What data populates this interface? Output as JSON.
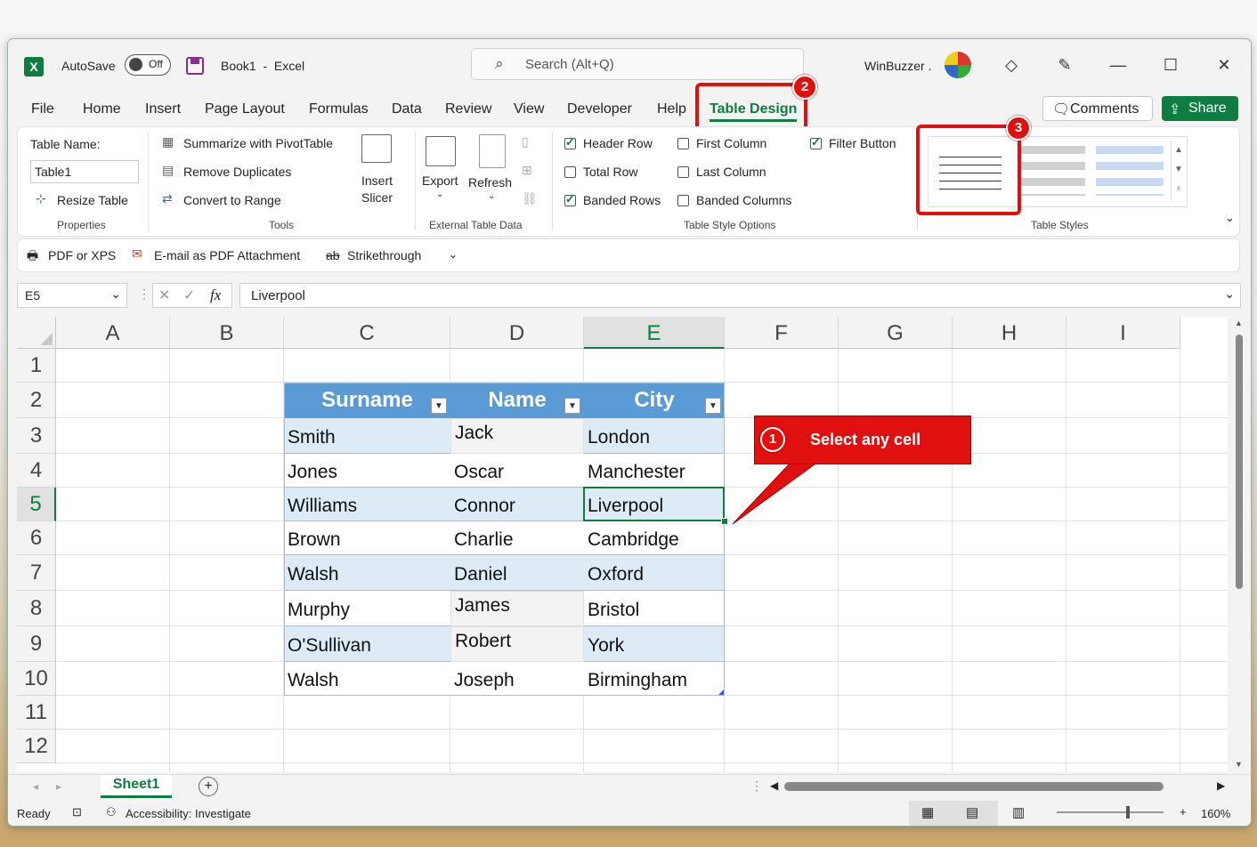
{
  "title_bar": {
    "autosave_label": "AutoSave",
    "autosave_state": "Off",
    "document_title": "Book1  -  Excel",
    "search_placeholder": "Search (Alt+Q)",
    "user_name": "WinBuzzer ."
  },
  "tabs": [
    "File",
    "Home",
    "Insert",
    "Page Layout",
    "Formulas",
    "Data",
    "Review",
    "View",
    "Developer",
    "Help",
    "Table Design"
  ],
  "active_tab": "Table Design",
  "actions": {
    "comments": "Comments",
    "share": "Share"
  },
  "ribbon": {
    "properties": {
      "table_name_label": "Table Name:",
      "table_name_value": "Table1",
      "resize_table": "Resize Table",
      "group": "Properties"
    },
    "tools": {
      "summarize": "Summarize with PivotTable",
      "remove_duplicates": "Remove Duplicates",
      "convert_to_range": "Convert to Range",
      "insert_slicer_1": "Insert",
      "insert_slicer_2": "Slicer",
      "group": "Tools"
    },
    "external": {
      "export": "Export",
      "refresh": "Refresh",
      "group": "External Table Data"
    },
    "style_options": {
      "header_row": "Header Row",
      "total_row": "Total Row",
      "banded_rows": "Banded Rows",
      "first_column": "First Column",
      "last_column": "Last Column",
      "banded_columns": "Banded Columns",
      "filter_button": "Filter Button",
      "group": "Table Style Options"
    },
    "styles": {
      "group": "Table Styles"
    }
  },
  "quick_access": {
    "pdf": "PDF or XPS",
    "email_pdf": "E-mail as PDF Attachment",
    "strikethrough": "Strikethrough"
  },
  "formula_bar": {
    "name_box": "E5",
    "fx": "fx",
    "formula": "Liverpool"
  },
  "columns": [
    "A",
    "B",
    "C",
    "D",
    "E",
    "F",
    "G",
    "H",
    "I"
  ],
  "rows": [
    "1",
    "2",
    "3",
    "4",
    "5",
    "6",
    "7",
    "8",
    "9",
    "10",
    "11",
    "12"
  ],
  "table": {
    "headers": [
      "Surname",
      "Name",
      "City"
    ],
    "rows": [
      [
        "Smith",
        "Jack",
        "London"
      ],
      [
        "Jones",
        "Oscar",
        "Manchester"
      ],
      [
        "Williams",
        "Connor",
        "Liverpool"
      ],
      [
        "Brown",
        "Charlie",
        "Cambridge"
      ],
      [
        "Walsh",
        "Daniel",
        "Oxford"
      ],
      [
        "Murphy",
        "James",
        "Bristol"
      ],
      [
        "O'Sullivan",
        "Robert",
        "York"
      ],
      [
        "Walsh",
        "Joseph",
        "Birmingham"
      ]
    ]
  },
  "annotations": {
    "callout_text": "Select any cell",
    "step1": "1",
    "step2": "2",
    "step3": "3"
  },
  "sheet_tab": "Sheet1",
  "status": {
    "ready": "Ready",
    "accessibility": "Accessibility: Investigate",
    "zoom": "160%"
  },
  "colors": {
    "excel_green": "#107c41",
    "table_header": "#5b9bd5",
    "band": "#ddebf7",
    "annotation_red": "#e01010"
  }
}
